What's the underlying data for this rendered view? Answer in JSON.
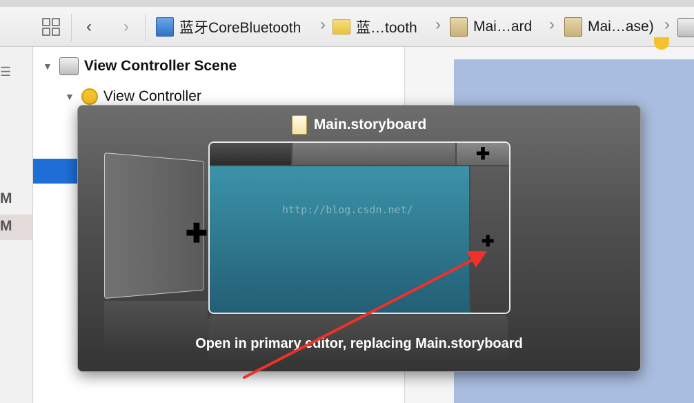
{
  "jumpbar": {
    "crumbs": [
      {
        "label": "蓝牙CoreBluetooth",
        "icon": "project-icon"
      },
      {
        "label": "蓝…tooth",
        "icon": "folder-icon"
      },
      {
        "label": "Mai…ard",
        "icon": "storyboard-icon"
      },
      {
        "label": "Mai…ase)",
        "icon": "storyboard-icon"
      }
    ]
  },
  "leftstrip": {
    "items": [
      "M",
      "M"
    ]
  },
  "outline": {
    "scene": "View Controller Scene",
    "controller": "View Controller"
  },
  "popup": {
    "title": "Main.storyboard",
    "watermark": "http://blog.csdn.net/",
    "caption": "Open in primary editor, replacing Main.storyboard"
  },
  "colors": {
    "selection": "#1f6ed8",
    "preview_pane": "#2f7f96",
    "arrow": "#f0302a",
    "canvas_view": "#a9bde0"
  }
}
